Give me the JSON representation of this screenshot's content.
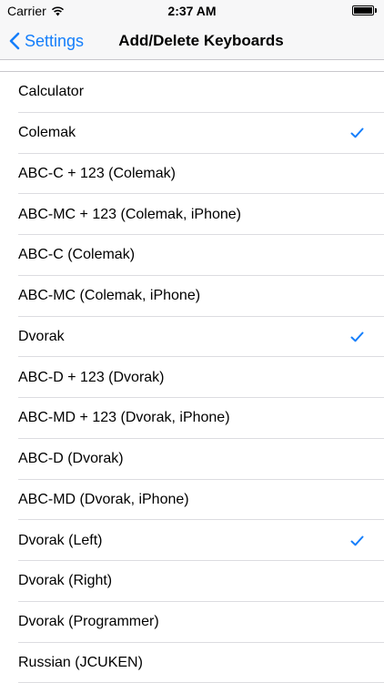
{
  "status_bar": {
    "carrier": "Carrier",
    "time": "2:37 AM"
  },
  "nav": {
    "back_label": "Settings",
    "title": "Add/Delete Keyboards"
  },
  "colors": {
    "accent": "#147efb"
  },
  "keyboards": [
    {
      "label": "Calculator",
      "checked": false
    },
    {
      "label": "Colemak",
      "checked": true
    },
    {
      "label": "ABC-C + 123 (Colemak)",
      "checked": false
    },
    {
      "label": "ABC-MC + 123 (Colemak, iPhone)",
      "checked": false
    },
    {
      "label": "ABC-C (Colemak)",
      "checked": false
    },
    {
      "label": "ABC-MC (Colemak, iPhone)",
      "checked": false
    },
    {
      "label": "Dvorak",
      "checked": true
    },
    {
      "label": "ABC-D + 123 (Dvorak)",
      "checked": false
    },
    {
      "label": "ABC-MD + 123 (Dvorak, iPhone)",
      "checked": false
    },
    {
      "label": "ABC-D (Dvorak)",
      "checked": false
    },
    {
      "label": "ABC-MD (Dvorak, iPhone)",
      "checked": false
    },
    {
      "label": "Dvorak (Left)",
      "checked": true
    },
    {
      "label": "Dvorak (Right)",
      "checked": false
    },
    {
      "label": "Dvorak (Programmer)",
      "checked": false
    },
    {
      "label": "Russian (JCUKEN)",
      "checked": false
    }
  ]
}
